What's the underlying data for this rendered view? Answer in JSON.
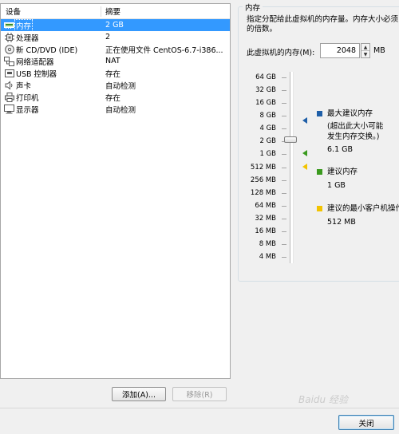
{
  "device_list": {
    "columns": {
      "device": "设备",
      "summary": "摘要"
    },
    "rows": [
      {
        "name": "内存",
        "summary": "2 GB",
        "icon": "memory-icon"
      },
      {
        "name": "处理器",
        "summary": "2",
        "icon": "cpu-icon"
      },
      {
        "name": "新 CD/DVD (IDE)",
        "summary": "正在使用文件 CentOS-6.7-i386...",
        "icon": "cd-dvd-icon"
      },
      {
        "name": "网络适配器",
        "summary": "NAT",
        "icon": "network-adapter-icon"
      },
      {
        "name": "USB 控制器",
        "summary": "存在",
        "icon": "usb-controller-icon"
      },
      {
        "name": "声卡",
        "summary": "自动检测",
        "icon": "sound-card-icon"
      },
      {
        "name": "打印机",
        "summary": "存在",
        "icon": "printer-icon"
      },
      {
        "name": "显示器",
        "summary": "自动检测",
        "icon": "display-icon"
      }
    ],
    "selected_index": 0
  },
  "buttons": {
    "add": "添加(A)...",
    "remove": "移除(R)",
    "close": "关闭"
  },
  "memory": {
    "group_title": "内存",
    "description_line1": "指定分配给此虚拟机的内存量。内存大小必须",
    "description_line2": "的倍数。",
    "input_label": "此虚拟机的内存(M):",
    "value": "2048",
    "unit": "MB",
    "scale": [
      "64 GB",
      "32 GB",
      "16 GB",
      "8 GB",
      "4 GB",
      "2 GB",
      "1 GB",
      "512 MB",
      "256 MB",
      "128 MB",
      "64 MB",
      "32 MB",
      "16 MB",
      "8 MB",
      "4 MB"
    ],
    "legend": {
      "max": {
        "title": "最大建议内存",
        "note1": "(超出此大小可能",
        "note2": "发生内存交换。)",
        "value": "6.1 GB",
        "color": "#1f5fa8"
      },
      "recommended": {
        "title": "建议内存",
        "value": "1 GB",
        "color": "#3a9a1e"
      },
      "min_guest": {
        "title": "建议的最小客户机操作",
        "value": "512 MB",
        "color": "#f2c300"
      }
    }
  },
  "watermark": "Baidu 经验"
}
